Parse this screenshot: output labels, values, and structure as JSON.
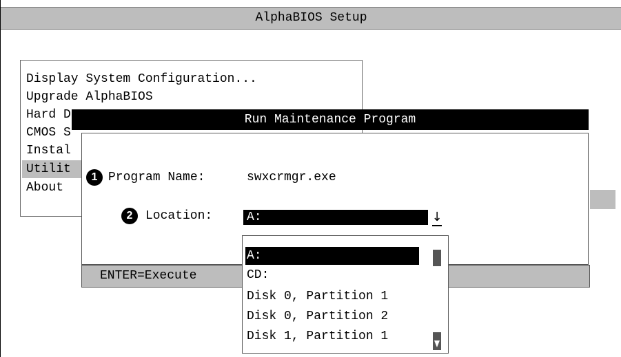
{
  "window": {
    "title": "AlphaBIOS Setup"
  },
  "menu": {
    "items": [
      {
        "label": "Display System Configuration..."
      },
      {
        "label": "Upgrade AlphaBIOS"
      },
      {
        "label": "Hard D"
      },
      {
        "label": "CMOS S"
      },
      {
        "label": "Instal"
      },
      {
        "label": "Utilit"
      },
      {
        "label": "About"
      }
    ],
    "selected_index": 5
  },
  "dialog": {
    "title": "Run Maintenance Program",
    "callouts": [
      "1",
      "2"
    ],
    "program_name_label": "Program Name:",
    "program_name_value": "swxcrmgr.exe",
    "location_label": "Location:",
    "location_value": "A:"
  },
  "statusbar": {
    "text": "ENTER=Execute"
  },
  "dropdown": {
    "options": [
      "A:",
      "CD:",
      "Disk 0, Partition 1",
      "Disk 0, Partition 2",
      "Disk 1, Partition 1"
    ],
    "selected_index": 0
  },
  "icons": {
    "dropdown_arrow": "down-arrow-icon",
    "scroll_down": "scroll-down-arrow-icon"
  }
}
